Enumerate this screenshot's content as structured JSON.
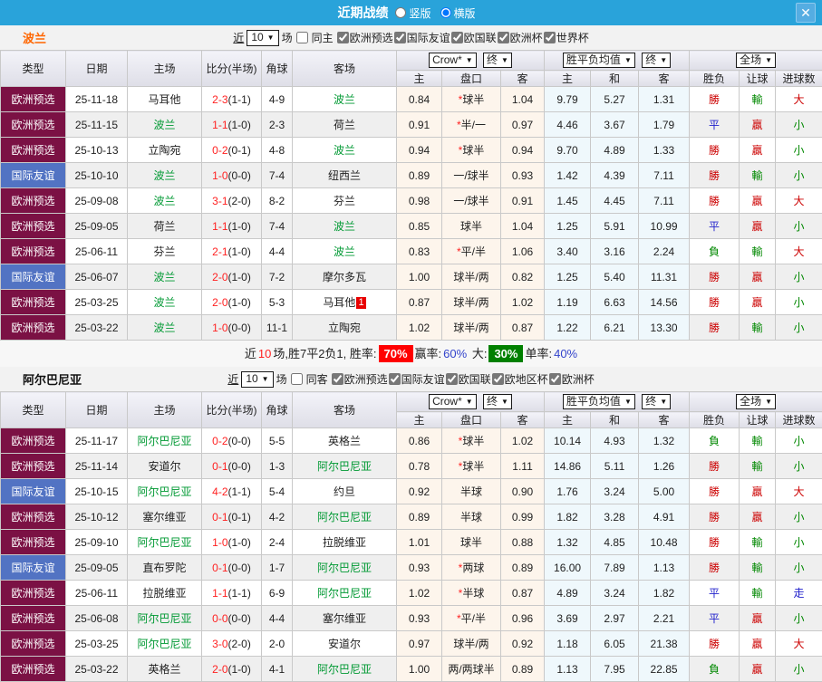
{
  "titlebar": {
    "title": "近期战绩",
    "radio_vertical": "竖版",
    "radio_horizontal": "横版",
    "close_icon": "✕"
  },
  "table_header": {
    "type": "类型",
    "date": "日期",
    "home": "主场",
    "score": "比分(半场)",
    "corners": "角球",
    "away": "客场",
    "odds_select": "Crow*",
    "final_select": "终",
    "avg_select": "胜平负均值",
    "final_select2": "终",
    "full_select": "全场",
    "arrow": "▼",
    "sub_home": "主",
    "sub_handicap": "盘口",
    "sub_away": "客",
    "sub_avg_home": "主",
    "sub_avg_draw": "和",
    "sub_avg_away": "客",
    "sub_result": "胜负",
    "sub_handicap_result": "让球",
    "sub_goals": "进球数"
  },
  "colors": {
    "titlebar_blue": "#29a3da",
    "type_maroon": "#7b1144",
    "type_blue": "#5273c3",
    "team_green": "#009933",
    "score_red": "#ff2222",
    "result_red": "#cc0000",
    "result_green": "#008800",
    "result_blue": "#2222cc",
    "win_rate_bg": "#ff0000",
    "big_rate_bg": "#008000",
    "poland_title": "#ff6600"
  },
  "sections": [
    {
      "team": "波兰",
      "filter": {
        "near_label": "近",
        "count": "10",
        "games_label": "场",
        "same_label": "同主",
        "leagues": [
          "欧洲预选",
          "国际友谊",
          "欧国联",
          "欧洲杯",
          "世界杯"
        ]
      },
      "rows": [
        {
          "type": "欧洲预选",
          "type_c": "maroon",
          "date": "25-11-18",
          "home": "马耳他",
          "home_green": false,
          "home_extra": null,
          "score": "2-3",
          "half": "(1-1)",
          "corners": "4-9",
          "away": "波兰",
          "away_green": true,
          "away_extra": null,
          "o_home": "0.84",
          "h_star": "*",
          "h_text": "球半",
          "o_away": "1.04",
          "avg_home": "9.79",
          "avg_draw": "5.27",
          "avg_away": "1.31",
          "res": {
            "t": "勝",
            "c": "red"
          },
          "hres": {
            "t": "輸",
            "c": "green"
          },
          "gres": {
            "t": "大",
            "c": "red"
          }
        },
        {
          "type": "欧洲预选",
          "type_c": "maroon",
          "date": "25-11-15",
          "home": "波兰",
          "home_green": true,
          "home_extra": null,
          "score": "1-1",
          "half": "(1-0)",
          "corners": "2-3",
          "away": "荷兰",
          "away_green": false,
          "away_extra": null,
          "o_home": "0.91",
          "h_star": "*",
          "h_text": "半/一",
          "o_away": "0.97",
          "avg_home": "4.46",
          "avg_draw": "3.67",
          "avg_away": "1.79",
          "res": {
            "t": "平",
            "c": "blue"
          },
          "hres": {
            "t": "贏",
            "c": "red"
          },
          "gres": {
            "t": "小",
            "c": "green"
          }
        },
        {
          "type": "欧洲预选",
          "type_c": "maroon",
          "date": "25-10-13",
          "home": "立陶宛",
          "home_green": false,
          "home_extra": null,
          "score": "0-2",
          "half": "(0-1)",
          "corners": "4-8",
          "away": "波兰",
          "away_green": true,
          "away_extra": null,
          "o_home": "0.94",
          "h_star": "*",
          "h_text": "球半",
          "o_away": "0.94",
          "avg_home": "9.70",
          "avg_draw": "4.89",
          "avg_away": "1.33",
          "res": {
            "t": "勝",
            "c": "red"
          },
          "hres": {
            "t": "贏",
            "c": "red"
          },
          "gres": {
            "t": "小",
            "c": "green"
          }
        },
        {
          "type": "国际友谊",
          "type_c": "blue",
          "date": "25-10-10",
          "home": "波兰",
          "home_green": true,
          "home_extra": null,
          "score": "1-0",
          "half": "(0-0)",
          "corners": "7-4",
          "away": "纽西兰",
          "away_green": false,
          "away_extra": null,
          "o_home": "0.89",
          "h_star": "",
          "h_text": "一/球半",
          "o_away": "0.93",
          "avg_home": "1.42",
          "avg_draw": "4.39",
          "avg_away": "7.11",
          "res": {
            "t": "勝",
            "c": "red"
          },
          "hres": {
            "t": "輸",
            "c": "green"
          },
          "gres": {
            "t": "小",
            "c": "green"
          }
        },
        {
          "type": "欧洲预选",
          "type_c": "maroon",
          "date": "25-09-08",
          "home": "波兰",
          "home_green": true,
          "home_extra": null,
          "score": "3-1",
          "half": "(2-0)",
          "corners": "8-2",
          "away": "芬兰",
          "away_green": false,
          "away_extra": null,
          "o_home": "0.98",
          "h_star": "",
          "h_text": "一/球半",
          "o_away": "0.91",
          "avg_home": "1.45",
          "avg_draw": "4.45",
          "avg_away": "7.11",
          "res": {
            "t": "勝",
            "c": "red"
          },
          "hres": {
            "t": "贏",
            "c": "red"
          },
          "gres": {
            "t": "大",
            "c": "red"
          }
        },
        {
          "type": "欧洲预选",
          "type_c": "maroon",
          "date": "25-09-05",
          "home": "荷兰",
          "home_green": false,
          "home_extra": null,
          "score": "1-1",
          "half": "(1-0)",
          "corners": "7-4",
          "away": "波兰",
          "away_green": true,
          "away_extra": null,
          "o_home": "0.85",
          "h_star": "",
          "h_text": "球半",
          "o_away": "1.04",
          "avg_home": "1.25",
          "avg_draw": "5.91",
          "avg_away": "10.99",
          "res": {
            "t": "平",
            "c": "blue"
          },
          "hres": {
            "t": "贏",
            "c": "red"
          },
          "gres": {
            "t": "小",
            "c": "green"
          }
        },
        {
          "type": "欧洲预选",
          "type_c": "maroon",
          "date": "25-06-11",
          "home": "芬兰",
          "home_green": false,
          "home_extra": null,
          "score": "2-1",
          "half": "(1-0)",
          "corners": "4-4",
          "away": "波兰",
          "away_green": true,
          "away_extra": null,
          "o_home": "0.83",
          "h_star": "*",
          "h_text": "平/半",
          "o_away": "1.06",
          "avg_home": "3.40",
          "avg_draw": "3.16",
          "avg_away": "2.24",
          "res": {
            "t": "負",
            "c": "green"
          },
          "hres": {
            "t": "輸",
            "c": "green"
          },
          "gres": {
            "t": "大",
            "c": "red"
          }
        },
        {
          "type": "国际友谊",
          "type_c": "blue",
          "date": "25-06-07",
          "home": "波兰",
          "home_green": true,
          "home_extra": null,
          "score": "2-0",
          "half": "(1-0)",
          "corners": "7-2",
          "away": "摩尔多瓦",
          "away_green": false,
          "away_extra": null,
          "o_home": "1.00",
          "h_star": "",
          "h_text": "球半/两",
          "o_away": "0.82",
          "avg_home": "1.25",
          "avg_draw": "5.40",
          "avg_away": "11.31",
          "res": {
            "t": "勝",
            "c": "red"
          },
          "hres": {
            "t": "贏",
            "c": "red"
          },
          "gres": {
            "t": "小",
            "c": "green"
          }
        },
        {
          "type": "欧洲预选",
          "type_c": "maroon",
          "date": "25-03-25",
          "home": "波兰",
          "home_green": true,
          "home_extra": null,
          "score": "2-0",
          "half": "(1-0)",
          "corners": "5-3",
          "away": "马耳他",
          "away_green": false,
          "away_extra": "1",
          "o_home": "0.87",
          "h_star": "",
          "h_text": "球半/两",
          "o_away": "1.02",
          "avg_home": "1.19",
          "avg_draw": "6.63",
          "avg_away": "14.56",
          "res": {
            "t": "勝",
            "c": "red"
          },
          "hres": {
            "t": "贏",
            "c": "red"
          },
          "gres": {
            "t": "小",
            "c": "green"
          }
        },
        {
          "type": "欧洲预选",
          "type_c": "maroon",
          "date": "25-03-22",
          "home": "波兰",
          "home_green": true,
          "home_extra": null,
          "score": "1-0",
          "half": "(0-0)",
          "corners": "11-1",
          "away": "立陶宛",
          "away_green": false,
          "away_extra": null,
          "o_home": "1.02",
          "h_star": "",
          "h_text": "球半/两",
          "o_away": "0.87",
          "avg_home": "1.22",
          "avg_draw": "6.21",
          "avg_away": "13.30",
          "res": {
            "t": "勝",
            "c": "red"
          },
          "hres": {
            "t": "輸",
            "c": "green"
          },
          "gres": {
            "t": "小",
            "c": "green"
          }
        }
      ],
      "summary": {
        "prefix": "近",
        "count": "10",
        "mid": "场,胜7平2负1, 胜率:",
        "win_rate": "70%",
        "win_label": "赢率:",
        "win_pct": "60%",
        "big_label": "大:",
        "big_rate": "30%",
        "single_label": "单率:",
        "single_pct": "40%"
      }
    },
    {
      "team": "阿尔巴尼亚",
      "filter": {
        "near_label": "近",
        "count": "10",
        "games_label": "场",
        "same_label": "同客",
        "leagues": [
          "欧洲预选",
          "国际友谊",
          "欧国联",
          "欧地区杯",
          "欧洲杯"
        ]
      },
      "rows": [
        {
          "type": "欧洲预选",
          "type_c": "maroon",
          "date": "25-11-17",
          "home": "阿尔巴尼亚",
          "home_green": true,
          "home_extra": null,
          "score": "0-2",
          "half": "(0-0)",
          "corners": "5-5",
          "away": "英格兰",
          "away_green": false,
          "away_extra": null,
          "o_home": "0.86",
          "h_star": "*",
          "h_text": "球半",
          "o_away": "1.02",
          "avg_home": "10.14",
          "avg_draw": "4.93",
          "avg_away": "1.32",
          "res": {
            "t": "負",
            "c": "green"
          },
          "hres": {
            "t": "輸",
            "c": "green"
          },
          "gres": {
            "t": "小",
            "c": "green"
          }
        },
        {
          "type": "欧洲预选",
          "type_c": "maroon",
          "date": "25-11-14",
          "home": "安道尔",
          "home_green": false,
          "home_extra": null,
          "score": "0-1",
          "half": "(0-0)",
          "corners": "1-3",
          "away": "阿尔巴尼亚",
          "away_green": true,
          "away_extra": null,
          "o_home": "0.78",
          "h_star": "*",
          "h_text": "球半",
          "o_away": "1.11",
          "avg_home": "14.86",
          "avg_draw": "5.11",
          "avg_away": "1.26",
          "res": {
            "t": "勝",
            "c": "red"
          },
          "hres": {
            "t": "輸",
            "c": "green"
          },
          "gres": {
            "t": "小",
            "c": "green"
          }
        },
        {
          "type": "国际友谊",
          "type_c": "blue",
          "date": "25-10-15",
          "home": "阿尔巴尼亚",
          "home_green": true,
          "home_extra": null,
          "score": "4-2",
          "half": "(1-1)",
          "corners": "5-4",
          "away": "约旦",
          "away_green": false,
          "away_extra": null,
          "o_home": "0.92",
          "h_star": "",
          "h_text": "半球",
          "o_away": "0.90",
          "avg_home": "1.76",
          "avg_draw": "3.24",
          "avg_away": "5.00",
          "res": {
            "t": "勝",
            "c": "red"
          },
          "hres": {
            "t": "贏",
            "c": "red"
          },
          "gres": {
            "t": "大",
            "c": "red"
          }
        },
        {
          "type": "欧洲预选",
          "type_c": "maroon",
          "date": "25-10-12",
          "home": "塞尔维亚",
          "home_green": false,
          "home_extra": null,
          "score": "0-1",
          "half": "(0-1)",
          "corners": "4-2",
          "away": "阿尔巴尼亚",
          "away_green": true,
          "away_extra": null,
          "o_home": "0.89",
          "h_star": "",
          "h_text": "半球",
          "o_away": "0.99",
          "avg_home": "1.82",
          "avg_draw": "3.28",
          "avg_away": "4.91",
          "res": {
            "t": "勝",
            "c": "red"
          },
          "hres": {
            "t": "贏",
            "c": "red"
          },
          "gres": {
            "t": "小",
            "c": "green"
          }
        },
        {
          "type": "欧洲预选",
          "type_c": "maroon",
          "date": "25-09-10",
          "home": "阿尔巴尼亚",
          "home_green": true,
          "home_extra": null,
          "score": "1-0",
          "half": "(1-0)",
          "corners": "2-4",
          "away": "拉脱维亚",
          "away_green": false,
          "away_extra": null,
          "o_home": "1.01",
          "h_star": "",
          "h_text": "球半",
          "o_away": "0.88",
          "avg_home": "1.32",
          "avg_draw": "4.85",
          "avg_away": "10.48",
          "res": {
            "t": "勝",
            "c": "red"
          },
          "hres": {
            "t": "輸",
            "c": "green"
          },
          "gres": {
            "t": "小",
            "c": "green"
          }
        },
        {
          "type": "国际友谊",
          "type_c": "blue",
          "date": "25-09-05",
          "home": "直布罗陀",
          "home_green": false,
          "home_extra": null,
          "score": "0-1",
          "half": "(0-0)",
          "corners": "1-7",
          "away": "阿尔巴尼亚",
          "away_green": true,
          "away_extra": null,
          "o_home": "0.93",
          "h_star": "*",
          "h_text": "两球",
          "o_away": "0.89",
          "avg_home": "16.00",
          "avg_draw": "7.89",
          "avg_away": "1.13",
          "res": {
            "t": "勝",
            "c": "red"
          },
          "hres": {
            "t": "輸",
            "c": "green"
          },
          "gres": {
            "t": "小",
            "c": "green"
          }
        },
        {
          "type": "欧洲预选",
          "type_c": "maroon",
          "date": "25-06-11",
          "home": "拉脱维亚",
          "home_green": false,
          "home_extra": null,
          "score": "1-1",
          "half": "(1-1)",
          "corners": "6-9",
          "away": "阿尔巴尼亚",
          "away_green": true,
          "away_extra": null,
          "o_home": "1.02",
          "h_star": "*",
          "h_text": "半球",
          "o_away": "0.87",
          "avg_home": "4.89",
          "avg_draw": "3.24",
          "avg_away": "1.82",
          "res": {
            "t": "平",
            "c": "blue"
          },
          "hres": {
            "t": "輸",
            "c": "green"
          },
          "gres": {
            "t": "走",
            "c": "blue"
          }
        },
        {
          "type": "欧洲预选",
          "type_c": "maroon",
          "date": "25-06-08",
          "home": "阿尔巴尼亚",
          "home_green": true,
          "home_extra": null,
          "score": "0-0",
          "half": "(0-0)",
          "corners": "4-4",
          "away": "塞尔维亚",
          "away_green": false,
          "away_extra": null,
          "o_home": "0.93",
          "h_star": "*",
          "h_text": "平/半",
          "o_away": "0.96",
          "avg_home": "3.69",
          "avg_draw": "2.97",
          "avg_away": "2.21",
          "res": {
            "t": "平",
            "c": "blue"
          },
          "hres": {
            "t": "贏",
            "c": "red"
          },
          "gres": {
            "t": "小",
            "c": "green"
          }
        },
        {
          "type": "欧洲预选",
          "type_c": "maroon",
          "date": "25-03-25",
          "home": "阿尔巴尼亚",
          "home_green": true,
          "home_extra": null,
          "score": "3-0",
          "half": "(2-0)",
          "corners": "2-0",
          "away": "安道尔",
          "away_green": false,
          "away_extra": null,
          "o_home": "0.97",
          "h_star": "",
          "h_text": "球半/两",
          "o_away": "0.92",
          "avg_home": "1.18",
          "avg_draw": "6.05",
          "avg_away": "21.38",
          "res": {
            "t": "勝",
            "c": "red"
          },
          "hres": {
            "t": "贏",
            "c": "red"
          },
          "gres": {
            "t": "大",
            "c": "red"
          }
        },
        {
          "type": "欧洲预选",
          "type_c": "maroon",
          "date": "25-03-22",
          "home": "英格兰",
          "home_green": false,
          "home_extra": null,
          "score": "2-0",
          "half": "(1-0)",
          "corners": "4-1",
          "away": "阿尔巴尼亚",
          "away_green": true,
          "away_extra": null,
          "o_home": "1.00",
          "h_star": "",
          "h_text": "两/两球半",
          "o_away": "0.89",
          "avg_home": "1.13",
          "avg_draw": "7.95",
          "avg_away": "22.85",
          "res": {
            "t": "負",
            "c": "green"
          },
          "hres": {
            "t": "贏",
            "c": "red"
          },
          "gres": {
            "t": "小",
            "c": "green"
          }
        }
      ],
      "summary": null
    }
  ]
}
